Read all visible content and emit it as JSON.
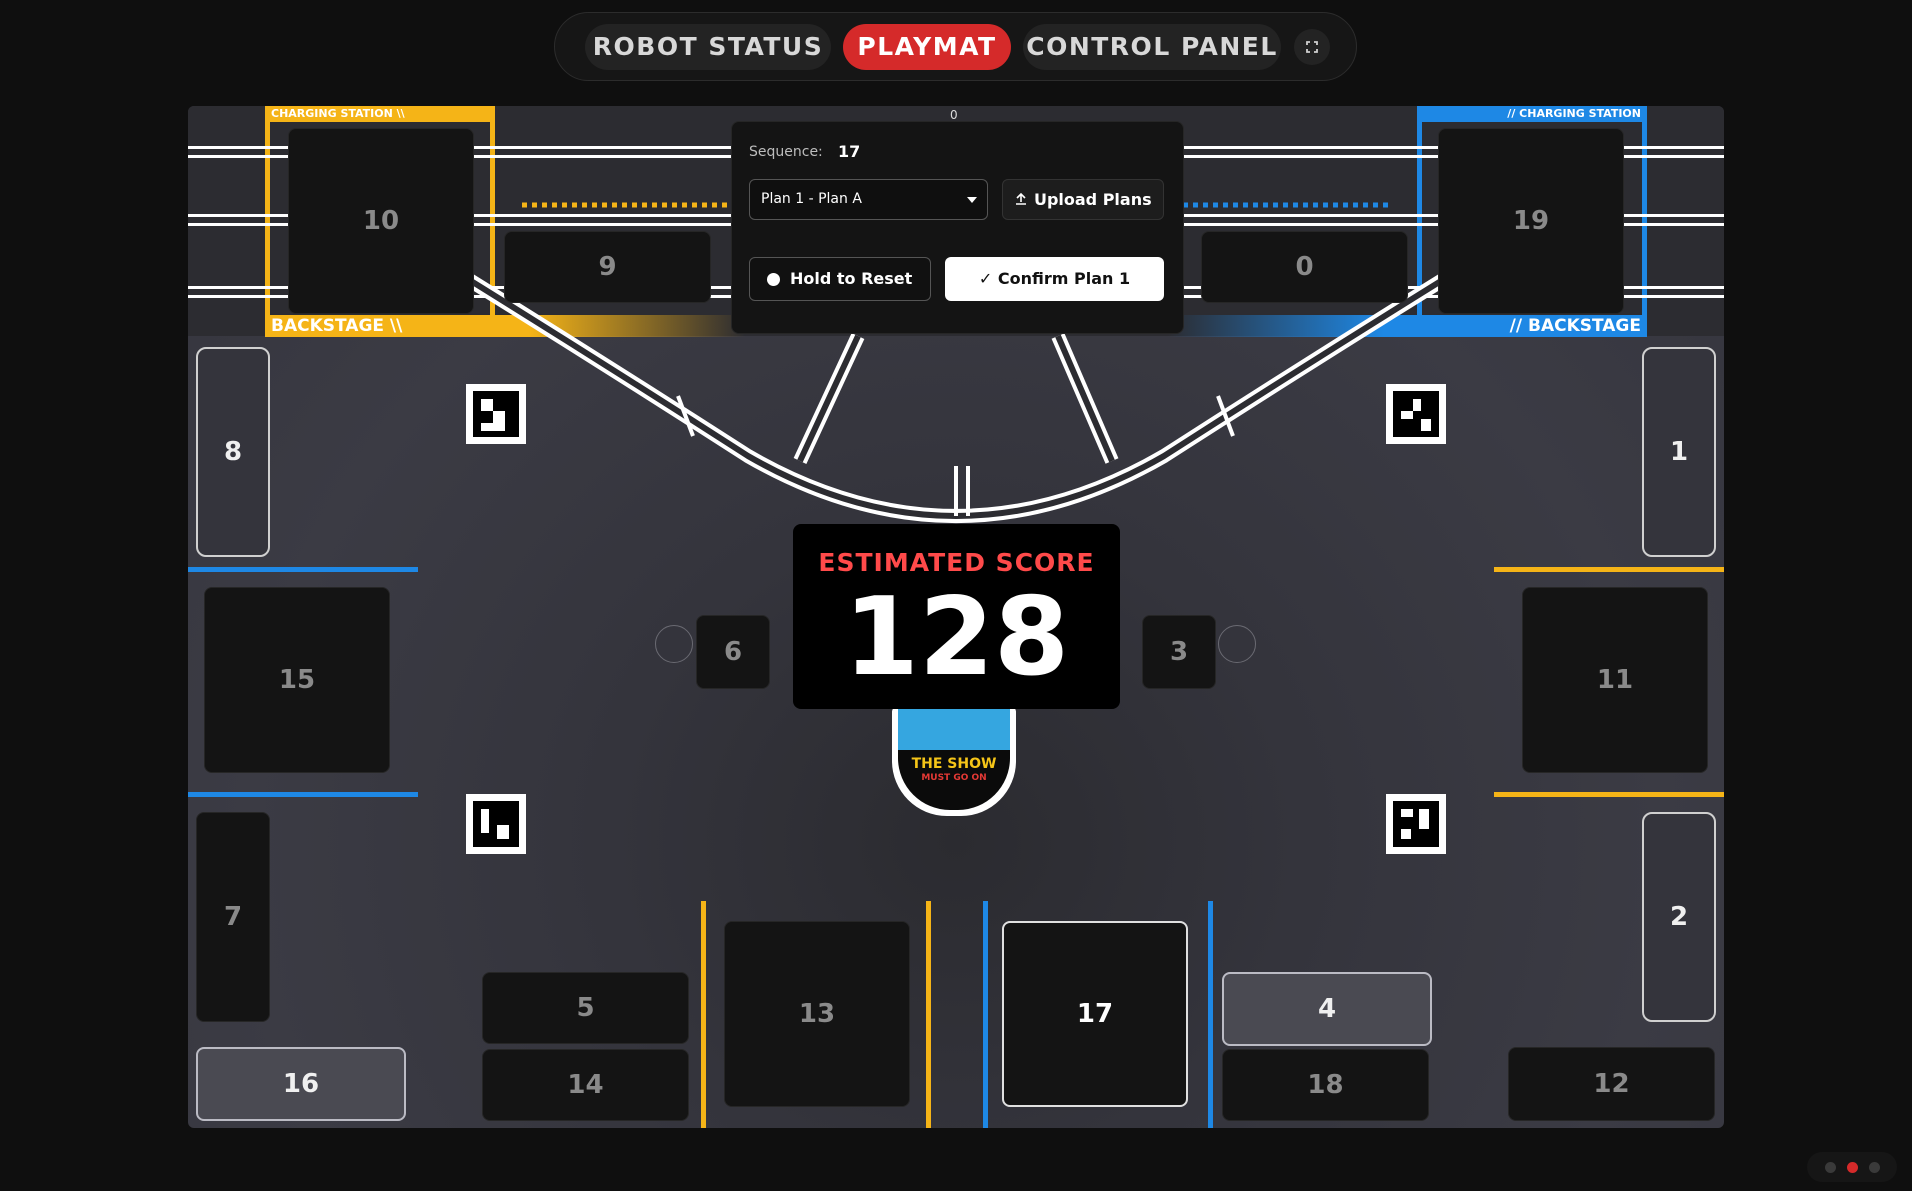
{
  "nav": {
    "tabs": [
      {
        "label": "ROBOT STATUS",
        "active": false
      },
      {
        "label": "PLAYMAT",
        "active": true
      },
      {
        "label": "CONTROL PANEL",
        "active": false
      }
    ],
    "expand_icon": "expand-icon"
  },
  "playmat": {
    "charging_station_left": "CHARGING STATION \\\\",
    "charging_station_right": "// CHARGING STATION",
    "backstage_left": "BACKSTAGE \\\\",
    "backstage_right": "// BACKSTAGE",
    "top_counter": "0",
    "zones": {
      "z0": "0",
      "z1": "1",
      "z2": "2",
      "z3": "3",
      "z4": "4",
      "z5": "5",
      "z6": "6",
      "z7": "7",
      "z8": "8",
      "z9": "9",
      "z10": "10",
      "z11": "11",
      "z12": "12",
      "z13": "13",
      "z14": "14",
      "z15": "15",
      "z16": "16",
      "z17": "17",
      "z18": "18",
      "z19": "19"
    },
    "accent_yellow": "#f5b417",
    "accent_blue": "#1e88e5"
  },
  "score": {
    "label": "ESTIMATED SCORE",
    "value": "128",
    "badge_title": "THE SHOW",
    "badge_sub": "MUST GO ON",
    "label_color": "#ff4a4a"
  },
  "control": {
    "sequence_label": "Sequence:",
    "sequence_value": "17",
    "plan_select": "Plan 1 - Plan A",
    "upload_label": "Upload Plans",
    "upload_icon": "upload-icon",
    "reset_label": "Hold to Reset",
    "confirm_label": "Confirm Plan 1",
    "confirm_icon": "check-icon"
  },
  "pager": {
    "count": 3,
    "active_index": 1
  }
}
